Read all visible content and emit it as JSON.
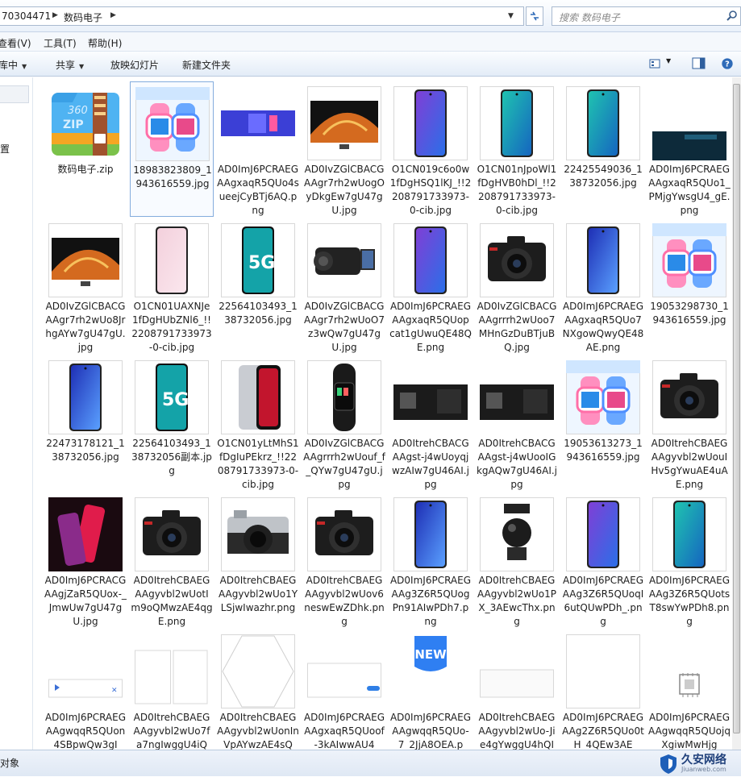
{
  "address": {
    "segment1": "70304471",
    "segment2": "数码电子"
  },
  "search": {
    "placeholder": "搜索 数码电子"
  },
  "menu": [
    "查看(V)",
    "工具(T)",
    "帮助(H)"
  ],
  "toolbar": {
    "organize": "库中",
    "share": "共享",
    "slideshow": "放映幻灯片",
    "new_folder": "新建文件夹"
  },
  "sidebar": {
    "item": "置"
  },
  "status": {
    "text": "对象"
  },
  "watermark": {
    "title": "久安网络",
    "url": "Jiuanweb.com"
  },
  "files": [
    {
      "name": "数码电子.zip",
      "kind": "zip"
    },
    {
      "name": "18983823809_1943616559.jpg",
      "kind": "watch",
      "selected": true
    },
    {
      "name": "AD0ImJ6PCRAEGAAgxaqR5QUo4sueejCyBTj6AQ.png",
      "kind": "banner"
    },
    {
      "name": "AD0IvZGlCBACGAAgr7rh2wUogOyDkgEw7gU47gU.jpg",
      "kind": "tv"
    },
    {
      "name": "O1CN019c6o0w1fDgHSQ1lKJ_!!2208791733973-0-cib.jpg",
      "kind": "phone-purple"
    },
    {
      "name": "O1CN01nJpoWl1fDgHVB0hDl_!!2208791733973-0-cib.jpg",
      "kind": "phone-teal"
    },
    {
      "name": "22425549036_138732056.jpg",
      "kind": "phone-teal"
    },
    {
      "name": "AD0ImJ6PCRAEGAAgxaqR5QUo1_PMjgYwsgU4_gE.png",
      "kind": "banner-dark"
    },
    {
      "name": "AD0IvZGlCBACGAAgr7rh2wUo8JrhgAYw7gU47gU.jpg",
      "kind": "tv"
    },
    {
      "name": "O1CN01UAXNJe1fDgHUbZNl6_!!2208791733973-0-cib.jpg",
      "kind": "phone-pink"
    },
    {
      "name": "22564103493_138732056.jpg",
      "kind": "phone-5g"
    },
    {
      "name": "AD0IvZGlCBACGAAgr7rh2wUoO7z3wQw7gU47gU.jpg",
      "kind": "camcorder"
    },
    {
      "name": "AD0ImJ6PCRAEGAAgxaqR5QUopcat1gUwuQE48QE.png",
      "kind": "phone-purple"
    },
    {
      "name": "AD0IvZGlCBACGAAgrrrh2wUoo7MHnGzDuBTjuBQ.jpg",
      "kind": "camera"
    },
    {
      "name": "AD0ImJ6PCRAEGAAgxaqR5QUo7NXgowQwyQE48AE.png",
      "kind": "phone-blue"
    },
    {
      "name": "19053298730_1943616559.jpg",
      "kind": "watch"
    },
    {
      "name": "22473178121_138732056.jpg",
      "kind": "phone-blue"
    },
    {
      "name": "22564103493_138732056副本.jpg",
      "kind": "phone-5g"
    },
    {
      "name": "O1CN01yLtMhS1fDgIuPEkrz_!!2208791733973-0-cib.jpg",
      "kind": "phone-dark"
    },
    {
      "name": "AD0IvZGlCBACGAAgrrrh2wUouf_f_QYw7gU47gU.jpg",
      "kind": "band"
    },
    {
      "name": "AD0ItrehCBACGAAgst-j4wUoyqjwzAIw7gU46AI.jpg",
      "kind": "strip-dark"
    },
    {
      "name": "AD0ItrehCBACGAAgst-j4wUooIGkgAQw7gU46AI.jpg",
      "kind": "strip-dark"
    },
    {
      "name": "19053613273_1943616559.jpg",
      "kind": "watch"
    },
    {
      "name": "AD0ItrehCBAEGAAgyvbl2wUouIHv5gYwuAE4uAE.png",
      "kind": "camera"
    },
    {
      "name": "AD0ImJ6PCRACGAAgjZaR5QUox-_JmwUw7gU47gU.jpg",
      "kind": "red-phone"
    },
    {
      "name": "AD0ItrehCBAEGAAgyvbl2wUotIm9oQMwzAE4qgE.png",
      "kind": "camera"
    },
    {
      "name": "AD0ItrehCBAEGAAgyvbl2wUo1YLSjwIwazhr.png",
      "kind": "camera-silver"
    },
    {
      "name": "AD0ItrehCBAEGAAgyvbl2wUov6neswEwZDhk.png",
      "kind": "camera"
    },
    {
      "name": "AD0ImJ6PCRAEGAAg3Z6R5QUogPn91AIwPDh7.png",
      "kind": "phone-blue"
    },
    {
      "name": "AD0ItrehCBAEGAAgyvbl2wUo1PX_3AEwcThx.png",
      "kind": "tripod"
    },
    {
      "name": "AD0ImJ6PCRAEGAAg3Z6R5QUoqI6utQUwPDh_.png",
      "kind": "phone-purple"
    },
    {
      "name": "AD0ImJ6PCRAEGAAg3Z6R5QUotsT8swYwPDh8.png",
      "kind": "phone-teal"
    },
    {
      "name": "AD0ImJ6PCRAEGAAgwqqR5QUon4SBpwQw3gI",
      "kind": "blank-ad"
    },
    {
      "name": "AD0ItrehCBAEGAAgyvbl2wUo7fa7ngIwggU4iQ",
      "kind": "blank-cards"
    },
    {
      "name": "AD0ItrehCBAEGAAgyvbl2wUonInVpAYwzAE4sQ",
      "kind": "hexagon"
    },
    {
      "name": "AD0ImJ6PCRAEGAAgxaqR5QUoof-3kAIwwAU4",
      "kind": "blank-bar"
    },
    {
      "name": "AD0ImJ6PCRAEGAAgwqqR5QUo-7_2JjA8OEA.p",
      "kind": "new-badge",
      "badge": "NEW"
    },
    {
      "name": "AD0ItrehCBAEGAAgyvbl2wUo-Jie4gYwggU4hQI",
      "kind": "blank-strip"
    },
    {
      "name": "AD0ImJ6PCRAEGAAg2Z6R5QUo0tH_4QEw3AE",
      "kind": "blank-white"
    },
    {
      "name": "AD0ImJ6PCRAEGAAgwqqR5QUojqXgiwMwHjg",
      "kind": "chip-icon"
    }
  ]
}
